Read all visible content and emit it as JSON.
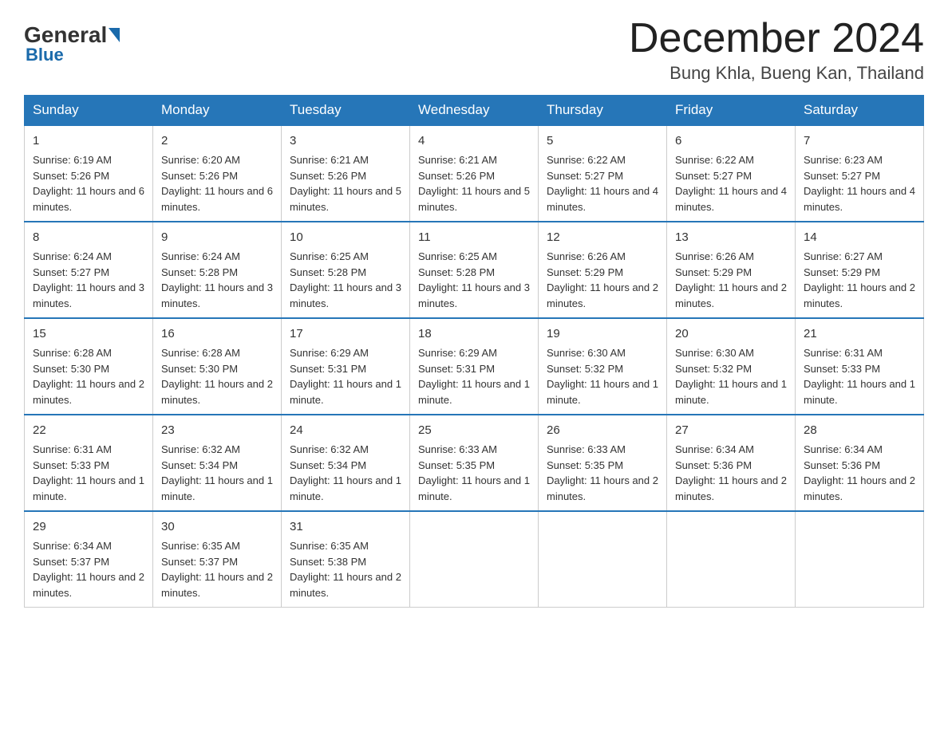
{
  "logo": {
    "general": "General",
    "blue": "Blue"
  },
  "title": {
    "month": "December 2024",
    "location": "Bung Khla, Bueng Kan, Thailand"
  },
  "weekdays": [
    "Sunday",
    "Monday",
    "Tuesday",
    "Wednesday",
    "Thursday",
    "Friday",
    "Saturday"
  ],
  "weeks": [
    [
      {
        "day": "1",
        "sunrise": "6:19 AM",
        "sunset": "5:26 PM",
        "daylight": "11 hours and 6 minutes."
      },
      {
        "day": "2",
        "sunrise": "6:20 AM",
        "sunset": "5:26 PM",
        "daylight": "11 hours and 6 minutes."
      },
      {
        "day": "3",
        "sunrise": "6:21 AM",
        "sunset": "5:26 PM",
        "daylight": "11 hours and 5 minutes."
      },
      {
        "day": "4",
        "sunrise": "6:21 AM",
        "sunset": "5:26 PM",
        "daylight": "11 hours and 5 minutes."
      },
      {
        "day": "5",
        "sunrise": "6:22 AM",
        "sunset": "5:27 PM",
        "daylight": "11 hours and 4 minutes."
      },
      {
        "day": "6",
        "sunrise": "6:22 AM",
        "sunset": "5:27 PM",
        "daylight": "11 hours and 4 minutes."
      },
      {
        "day": "7",
        "sunrise": "6:23 AM",
        "sunset": "5:27 PM",
        "daylight": "11 hours and 4 minutes."
      }
    ],
    [
      {
        "day": "8",
        "sunrise": "6:24 AM",
        "sunset": "5:27 PM",
        "daylight": "11 hours and 3 minutes."
      },
      {
        "day": "9",
        "sunrise": "6:24 AM",
        "sunset": "5:28 PM",
        "daylight": "11 hours and 3 minutes."
      },
      {
        "day": "10",
        "sunrise": "6:25 AM",
        "sunset": "5:28 PM",
        "daylight": "11 hours and 3 minutes."
      },
      {
        "day": "11",
        "sunrise": "6:25 AM",
        "sunset": "5:28 PM",
        "daylight": "11 hours and 3 minutes."
      },
      {
        "day": "12",
        "sunrise": "6:26 AM",
        "sunset": "5:29 PM",
        "daylight": "11 hours and 2 minutes."
      },
      {
        "day": "13",
        "sunrise": "6:26 AM",
        "sunset": "5:29 PM",
        "daylight": "11 hours and 2 minutes."
      },
      {
        "day": "14",
        "sunrise": "6:27 AM",
        "sunset": "5:29 PM",
        "daylight": "11 hours and 2 minutes."
      }
    ],
    [
      {
        "day": "15",
        "sunrise": "6:28 AM",
        "sunset": "5:30 PM",
        "daylight": "11 hours and 2 minutes."
      },
      {
        "day": "16",
        "sunrise": "6:28 AM",
        "sunset": "5:30 PM",
        "daylight": "11 hours and 2 minutes."
      },
      {
        "day": "17",
        "sunrise": "6:29 AM",
        "sunset": "5:31 PM",
        "daylight": "11 hours and 1 minute."
      },
      {
        "day": "18",
        "sunrise": "6:29 AM",
        "sunset": "5:31 PM",
        "daylight": "11 hours and 1 minute."
      },
      {
        "day": "19",
        "sunrise": "6:30 AM",
        "sunset": "5:32 PM",
        "daylight": "11 hours and 1 minute."
      },
      {
        "day": "20",
        "sunrise": "6:30 AM",
        "sunset": "5:32 PM",
        "daylight": "11 hours and 1 minute."
      },
      {
        "day": "21",
        "sunrise": "6:31 AM",
        "sunset": "5:33 PM",
        "daylight": "11 hours and 1 minute."
      }
    ],
    [
      {
        "day": "22",
        "sunrise": "6:31 AM",
        "sunset": "5:33 PM",
        "daylight": "11 hours and 1 minute."
      },
      {
        "day": "23",
        "sunrise": "6:32 AM",
        "sunset": "5:34 PM",
        "daylight": "11 hours and 1 minute."
      },
      {
        "day": "24",
        "sunrise": "6:32 AM",
        "sunset": "5:34 PM",
        "daylight": "11 hours and 1 minute."
      },
      {
        "day": "25",
        "sunrise": "6:33 AM",
        "sunset": "5:35 PM",
        "daylight": "11 hours and 1 minute."
      },
      {
        "day": "26",
        "sunrise": "6:33 AM",
        "sunset": "5:35 PM",
        "daylight": "11 hours and 2 minutes."
      },
      {
        "day": "27",
        "sunrise": "6:34 AM",
        "sunset": "5:36 PM",
        "daylight": "11 hours and 2 minutes."
      },
      {
        "day": "28",
        "sunrise": "6:34 AM",
        "sunset": "5:36 PM",
        "daylight": "11 hours and 2 minutes."
      }
    ],
    [
      {
        "day": "29",
        "sunrise": "6:34 AM",
        "sunset": "5:37 PM",
        "daylight": "11 hours and 2 minutes."
      },
      {
        "day": "30",
        "sunrise": "6:35 AM",
        "sunset": "5:37 PM",
        "daylight": "11 hours and 2 minutes."
      },
      {
        "day": "31",
        "sunrise": "6:35 AM",
        "sunset": "5:38 PM",
        "daylight": "11 hours and 2 minutes."
      },
      null,
      null,
      null,
      null
    ]
  ]
}
